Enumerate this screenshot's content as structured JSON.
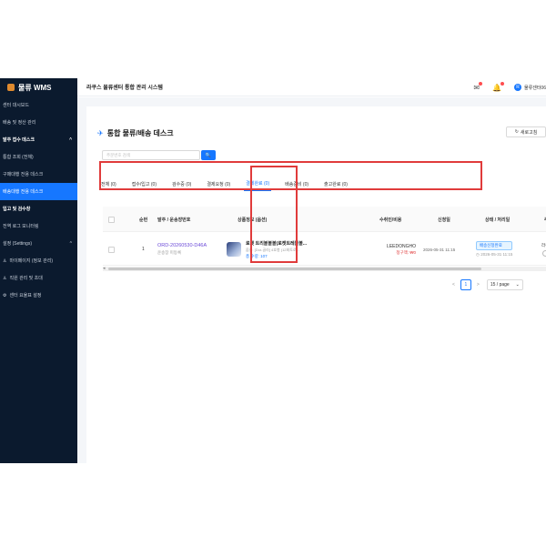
{
  "sidebar": {
    "brand": "물류 WMS",
    "items": [
      {
        "label": "센터 대시보드"
      },
      {
        "label": "배송 및 정산 관리"
      },
      {
        "label": "발주 접수 데스크",
        "chevron": "^"
      },
      {
        "label": "통합 조회 (전체)"
      },
      {
        "label": "구매대행 전용 데스크"
      },
      {
        "label": "배송대행 전용 데스크"
      },
      {
        "label": "입고 및 검수창"
      },
      {
        "label": "전역 로그 모니터링"
      },
      {
        "label": "설정 (Settings)",
        "chevron": "^"
      },
      {
        "label": "마이페이지 (정보 관리)"
      },
      {
        "label": "직원 관리 및 초대"
      },
      {
        "label": "센터 요율표 설정"
      }
    ]
  },
  "header": {
    "title": "라쿠스 물류센터 통합 관리 시스템",
    "user_name": "물류센터06",
    "user_initial": "R"
  },
  "page": {
    "title": "통합 물류/배송 데스크",
    "refresh_label": "새로고침",
    "search_placeholder": "주문번호 검색",
    "search_icon": "🔍"
  },
  "tabs": [
    {
      "label": "전체 (0)"
    },
    {
      "label": "접수/입고 (0)"
    },
    {
      "label": "검수중 (0)"
    },
    {
      "label": "결제요청 (0)"
    },
    {
      "label": "결제완료 (0)"
    },
    {
      "label": "배송준비 (0)"
    },
    {
      "label": "출고완료 (0)"
    }
  ],
  "table": {
    "headers": [
      "순번",
      "발주 / 운송장번호",
      "상품정보 (옵션)",
      "수취인/비용",
      "신청일",
      "상태 / 처리일",
      "주문"
    ],
    "rows": [
      {
        "index": "1",
        "order_no": "ORD-20260530-D46A",
        "tracking": "운송장 미등록",
        "product_name": "로켓 트리볼볼볼(로켓트레볼볼...",
        "product_option": "옵션: [Dor-골라] 4호봉 (12회토로...",
        "product_qty": "총 수량: 107",
        "receiver": "LEEDONGHO",
        "cost": "청구액: ₩0",
        "apply_date": "2026-05-31 11:15",
        "status": "배송신청완료",
        "status_date": "2026-05-31 11:15",
        "order_col": "라쿠"
      }
    ]
  },
  "pagination": {
    "prev": "<",
    "current": "1",
    "next": ">",
    "page_size": "15 / page"
  },
  "colors": {
    "sidebar_bg": "#0b1a2e",
    "accent": "#1677ff",
    "highlight": "#e03b3b"
  }
}
